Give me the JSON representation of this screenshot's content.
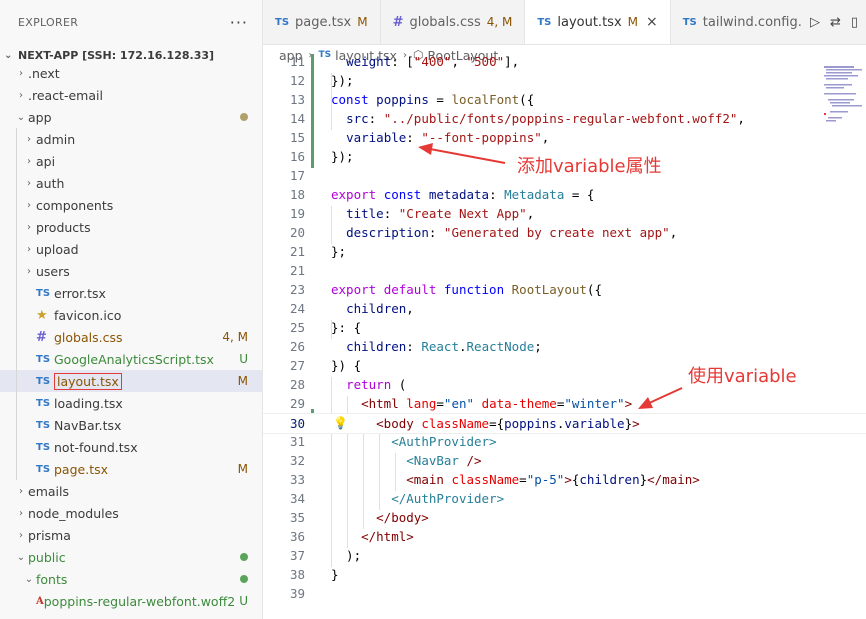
{
  "explorer": {
    "title": "EXPLORER",
    "more": "···",
    "root": "NEXT-APP [SSH: 172.16.128.33]",
    "items": [
      {
        "label": ".next",
        "type": "folder",
        "depth": 0,
        "open": false
      },
      {
        "label": ".react-email",
        "type": "folder",
        "depth": 0,
        "open": false
      },
      {
        "label": "app",
        "type": "folder",
        "depth": 0,
        "open": true,
        "dot": "#b0a06a"
      },
      {
        "label": "admin",
        "type": "folder",
        "depth": 1,
        "open": false
      },
      {
        "label": "api",
        "type": "folder",
        "depth": 1,
        "open": false
      },
      {
        "label": "auth",
        "type": "folder",
        "depth": 1,
        "open": false
      },
      {
        "label": "components",
        "type": "folder",
        "depth": 1,
        "open": false
      },
      {
        "label": "products",
        "type": "folder",
        "depth": 1,
        "open": false
      },
      {
        "label": "upload",
        "type": "folder",
        "depth": 1,
        "open": false
      },
      {
        "label": "users",
        "type": "folder",
        "depth": 1,
        "open": false
      },
      {
        "label": "error.tsx",
        "type": "ts",
        "depth": 1,
        "icon": "TS"
      },
      {
        "label": "favicon.ico",
        "type": "star",
        "depth": 1,
        "icon": "★"
      },
      {
        "label": "globals.css",
        "type": "css",
        "depth": 1,
        "icon": "#",
        "badge": "4, M",
        "badge_color": "#895503",
        "label_color": "#895503"
      },
      {
        "label": "GoogleAnalyticsScript.tsx",
        "type": "ts",
        "depth": 1,
        "icon": "TS",
        "badge": "U",
        "badge_color": "#3c8a3c",
        "label_color": "#3c8a3c"
      },
      {
        "label": "layout.tsx",
        "type": "ts",
        "depth": 1,
        "icon": "TS",
        "badge": "M",
        "badge_color": "#895503",
        "label_color": "#895503",
        "selected": true,
        "boxed": true
      },
      {
        "label": "loading.tsx",
        "type": "ts",
        "depth": 1,
        "icon": "TS"
      },
      {
        "label": "NavBar.tsx",
        "type": "ts",
        "depth": 1,
        "icon": "TS"
      },
      {
        "label": "not-found.tsx",
        "type": "ts",
        "depth": 1,
        "icon": "TS"
      },
      {
        "label": "page.tsx",
        "type": "ts",
        "depth": 1,
        "icon": "TS",
        "badge": "M",
        "badge_color": "#895503",
        "label_color": "#895503"
      },
      {
        "label": "emails",
        "type": "folder",
        "depth": 0,
        "open": false
      },
      {
        "label": "node_modules",
        "type": "folder",
        "depth": 0,
        "open": false
      },
      {
        "label": "prisma",
        "type": "folder",
        "depth": 0,
        "open": false
      },
      {
        "label": "public",
        "type": "folder",
        "depth": 0,
        "open": true,
        "dot": "#5aa55a",
        "label_color": "#3c8a3c"
      },
      {
        "label": "fonts",
        "type": "folder",
        "depth": 1,
        "open": true,
        "dot": "#5aa55a",
        "label_color": "#3c8a3c"
      },
      {
        "label": "poppins-regular-webfont.woff2",
        "type": "font",
        "depth": 2,
        "icon": "A",
        "badge": "U",
        "badge_color": "#3c8a3c",
        "label_color": "#3c8a3c"
      }
    ]
  },
  "tabs": [
    {
      "label": "page.tsx",
      "icon": "TS",
      "modified": "M",
      "active": false
    },
    {
      "label": "globals.css",
      "icon": "#",
      "modified": "4, M",
      "active": false
    },
    {
      "label": "layout.tsx",
      "icon": "TS",
      "modified": "M",
      "active": true,
      "close": "×"
    },
    {
      "label": "tailwind.config.t",
      "icon": "TS",
      "modified": "",
      "active": false
    }
  ],
  "breadcrumb": {
    "folder": "app",
    "file": "layout.tsx",
    "symbol": "RootLayout"
  },
  "annotations": {
    "first": "添加variable属性",
    "second": "使用variable"
  },
  "colors": {
    "accent": "#e53935",
    "git_added": "#5a9e6f",
    "modified": "#895503",
    "untracked": "#3c8a3c"
  }
}
